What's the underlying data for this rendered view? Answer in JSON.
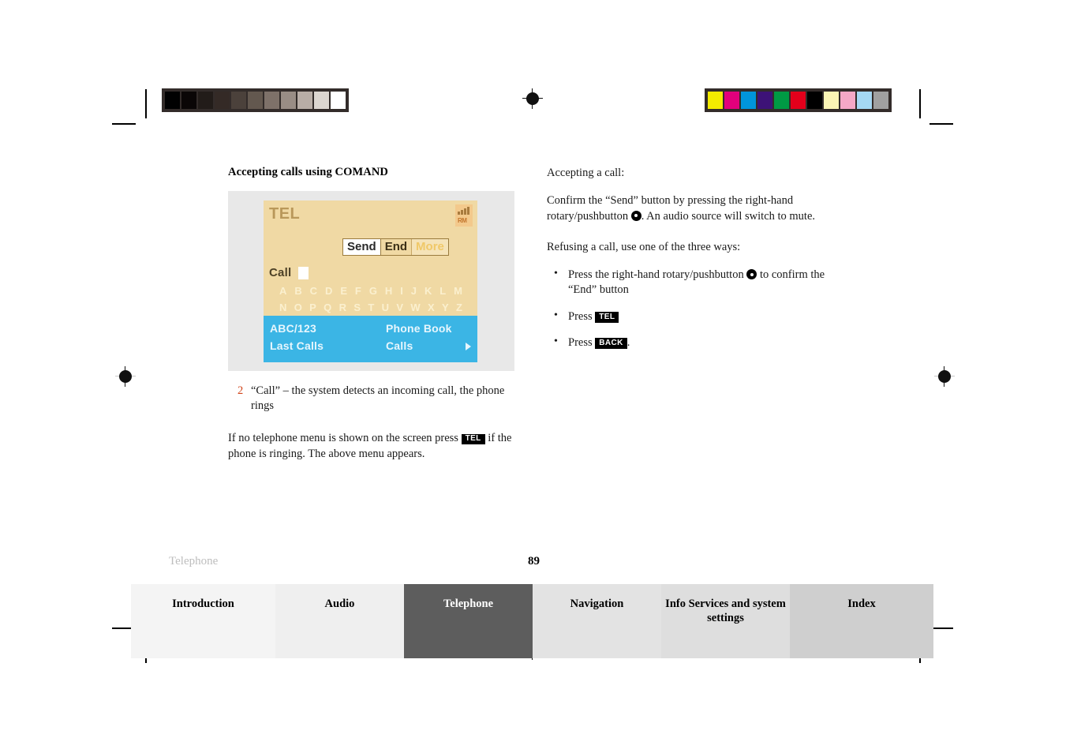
{
  "document": {
    "chapter_footer": "Telephone",
    "page_number": "89"
  },
  "left_column": {
    "section_title": "Accepting calls using COMAND",
    "figure": {
      "comand_screen": {
        "header_label": "TEL",
        "signal_roaming_label": "RM",
        "buttons": [
          {
            "label": "Send",
            "state": "selected"
          },
          {
            "label": "End",
            "state": "normal"
          },
          {
            "label": "More",
            "state": "dimmed"
          }
        ],
        "call_label": "Call",
        "alphabet_row_1": "A B C D E F G H I J K L M",
        "alphabet_row_2": "N O P Q R S T U V W X Y Z",
        "menu": {
          "top_left": "ABC/123",
          "bottom_left": "Last Calls",
          "top_right": "Phone Book",
          "bottom_right": "Calls"
        }
      }
    },
    "caption": {
      "number": "2",
      "text": "“Call” – the system detects an incoming call, the phone rings"
    },
    "note": {
      "before_key": "If no telephone menu is shown on the screen press",
      "key": "TEL",
      "after_key": "if the phone is ringing. The above menu appears."
    }
  },
  "right_column": {
    "heading_accept": "Accepting a call:",
    "accept_text_part1": "Confirm the “Send” button by pressing the right-hand rotary/pushbutton",
    "accept_text_part2": ". An audio source will switch to mute.",
    "heading_refuse": "Refusing a call, use one of the three ways:",
    "bullets": [
      {
        "before_glyph": "Press the right-hand rotary/pushbutton",
        "glyph": "rotary-pushbutton",
        "after_glyph": "to confirm the “End” button"
      },
      {
        "before_glyph": "Press",
        "glyph": "TEL",
        "after_glyph": ""
      },
      {
        "before_glyph": "Press",
        "glyph": "BACK",
        "after_glyph": "."
      }
    ]
  },
  "footer_tabs": [
    {
      "label": "Introduction",
      "active": false
    },
    {
      "label": "Audio",
      "active": false
    },
    {
      "label": "Telephone",
      "active": true
    },
    {
      "label": "Navigation",
      "active": false
    },
    {
      "label": "Info Services and system settings",
      "active": false
    },
    {
      "label": "Index",
      "active": false
    }
  ],
  "calibration": {
    "grayscale": [
      "#010101",
      "#0a0606",
      "#221c19",
      "#342a26",
      "#4b413b",
      "#63584f",
      "#7e7169",
      "#998d85",
      "#b8ada6",
      "#dcd6d0",
      "#ffffff"
    ],
    "colors": [
      "#f3eb00",
      "#e2007c",
      "#0095db",
      "#3d1277",
      "#009a44",
      "#e3001b",
      "#000000",
      "#fbf5b5",
      "#f5a8c6",
      "#a5d8f3",
      "#a0a0a0"
    ]
  }
}
